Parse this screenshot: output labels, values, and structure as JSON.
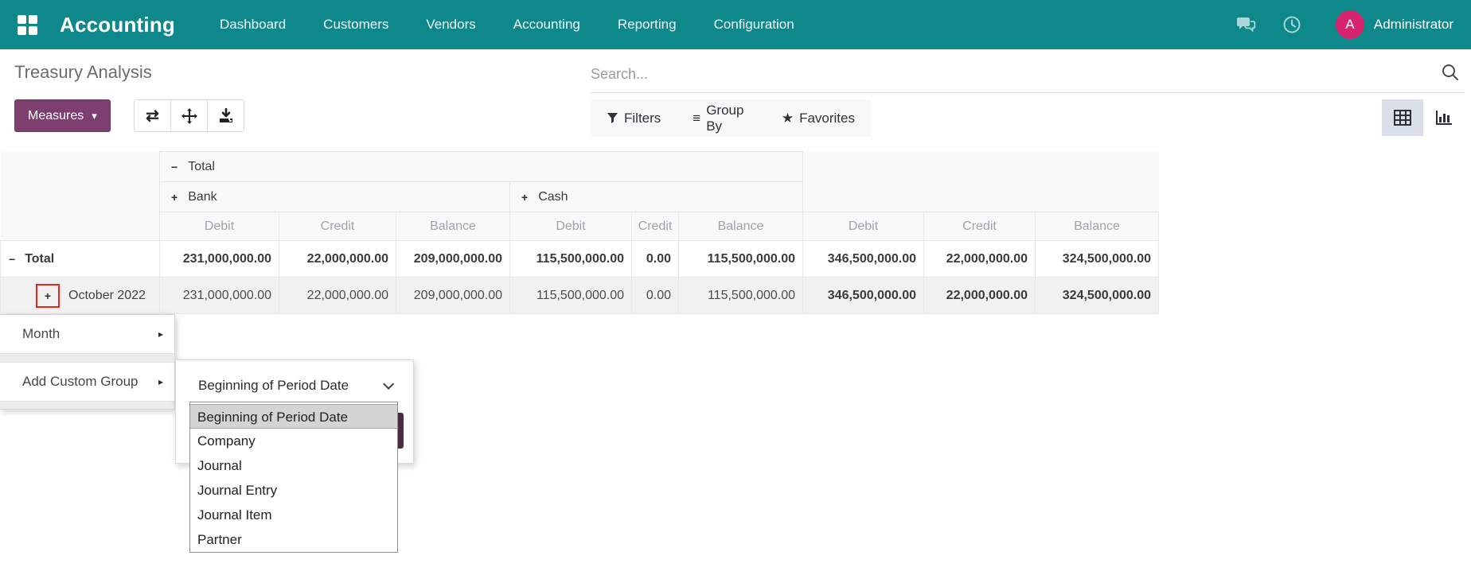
{
  "colors": {
    "navbar_bg": "#0e888a",
    "primary": "#7d3f6f",
    "primary_border": "#6a3560",
    "avatar_bg": "#d6246e",
    "annotation_red": "#de2a1b",
    "header_bg": "#f9f9f9",
    "row_alt_bg": "#f1f1f1",
    "active_view_bg": "#d9dee8",
    "option_highlight": "#d4d4d4",
    "apply_btn": "#4a2b42"
  },
  "icons": {
    "minus": "−",
    "plus": "+",
    "caret_down": "▾",
    "submenu_arrow": "▸",
    "menu_bars": "≡",
    "star": "★",
    "flip": "⇄"
  },
  "navbar": {
    "brand": "Accounting",
    "menu_items": [
      "Dashboard",
      "Customers",
      "Vendors",
      "Accounting",
      "Reporting",
      "Configuration"
    ],
    "user_initial": "A",
    "user_name": "Administrator"
  },
  "breadcrumb": {
    "title": "Treasury Analysis"
  },
  "toolbar": {
    "measures_label": "Measures"
  },
  "search": {
    "placeholder": "Search...",
    "filters_label": "Filters",
    "group_by_label": "Group By",
    "favorites_label": "Favorites"
  },
  "pivot": {
    "header": {
      "total_label": "Total",
      "bank_label": "Bank",
      "cash_label": "Cash",
      "measures": [
        "Debit",
        "Credit",
        "Balance"
      ]
    },
    "rows": [
      {
        "label": "Total",
        "values": [
          "231,000,000.00",
          "22,000,000.00",
          "209,000,000.00",
          "115,500,000.00",
          "0.00",
          "115,500,000.00",
          "346,500,000.00",
          "22,000,000.00",
          "324,500,000.00"
        ]
      },
      {
        "label": "October 2022",
        "values": [
          "231,000,000.00",
          "22,000,000.00",
          "209,000,000.00",
          "115,500,000.00",
          "0.00",
          "115,500,000.00",
          "346,500,000.00",
          "22,000,000.00",
          "324,500,000.00"
        ]
      }
    ]
  },
  "menu": {
    "items": [
      {
        "label": "Month"
      },
      {
        "label": "Add Custom Group"
      }
    ]
  },
  "custom_group": {
    "selected_value": "Beginning of Period Date",
    "options": [
      "Beginning of Period Date",
      "Company",
      "Journal",
      "Journal Entry",
      "Journal Item",
      "Partner"
    ]
  }
}
